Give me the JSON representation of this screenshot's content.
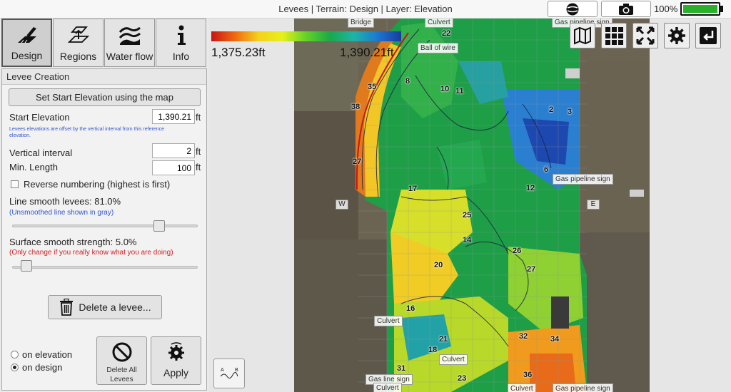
{
  "window": {
    "title": "Levees | Terrain: Design | Layer: Elevation",
    "battery": "100%",
    "battery_level": 1.0
  },
  "tabs": [
    {
      "label": "Design",
      "icon": "design-icon",
      "active": true
    },
    {
      "label": "Regions",
      "icon": "regions-icon",
      "active": false
    },
    {
      "label": "Water flow",
      "icon": "water-flow-icon",
      "active": false
    },
    {
      "label": "Info",
      "icon": "info-icon",
      "active": false
    }
  ],
  "panel": {
    "section_title": "Levee Creation",
    "set_start_button": "Set Start Elevation using the map",
    "start_elevation_label": "Start Elevation",
    "start_elevation_value": "1,390.21",
    "unit": "ft",
    "offset_note": "Levees elevations are offset by the vertical interval from this reference elevation.",
    "vertical_interval_label": "Vertical interval",
    "vertical_interval_value": "2",
    "min_length_label": "Min. Length",
    "min_length_value": "100",
    "reverse_label": "Reverse numbering (highest is first)",
    "reverse_checked": false,
    "line_smooth_label": "Line smooth levees: 81.0%",
    "line_smooth_note": "(Unsmoothed line shown in gray)",
    "line_smooth_value": 0.81,
    "surface_smooth_label": "Surface smooth strength: 5.0%",
    "surface_smooth_note": "(Only change if you really know what you are doing)",
    "surface_smooth_value": 0.05,
    "delete_levee_button": "Delete a levee...",
    "radio_on_elevation": "on elevation",
    "radio_on_design": "on design",
    "radio_selected": "on design",
    "delete_all_button": "Delete All Levees",
    "apply_button": "Apply"
  },
  "legend": {
    "min": "1,375.23ft",
    "max": "1,390.21ft"
  },
  "map": {
    "compass": {
      "west": "W",
      "east": "E"
    },
    "labels": {
      "bridge": "Bridge",
      "culvert_top": "Culvert",
      "ball_of_wire": "Ball of wire",
      "gas_pipeline_top": "Gas pipeline sign",
      "gas_pipeline_mid": "Gas pipeline sign",
      "culvert_mid": "Culvert",
      "culvert_low": "Culvert",
      "gas_line_sign": "Gas line sign",
      "culvert_bottom": "Culvert",
      "culvert_bottom2": "Culvert",
      "gas_pipeline_bottom": "Gas pipeline sign"
    },
    "levee_numbers": [
      "22",
      "35",
      "8",
      "10",
      "11",
      "38",
      "2",
      "3",
      "27",
      "6",
      "12",
      "17",
      "25",
      "14",
      "26",
      "20",
      "27",
      "16",
      "21",
      "18",
      "32",
      "34",
      "23",
      "36",
      "31"
    ]
  },
  "toolbar_icons": [
    "globe-icon",
    "camera-icon",
    "map-layers-icon",
    "grid-icon",
    "fit-extent-icon",
    "settings-icon",
    "exit-icon"
  ],
  "ab_label": "A  B"
}
